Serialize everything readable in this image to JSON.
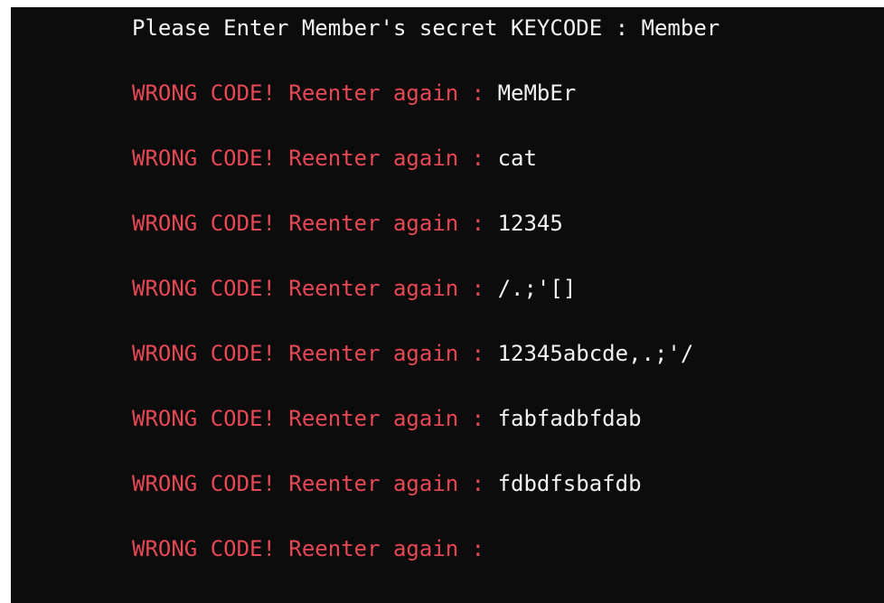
{
  "console": {
    "first_prompt": "Please Enter Member's secret KEYCODE : ",
    "first_input": "Member",
    "retry_prompt": "WRONG CODE! Reenter again : ",
    "retries": [
      "MeMbEr",
      "cat",
      "12345",
      "/.;'[]",
      "12345abcde,.;'/",
      "fabfadbfdab",
      "fdbdfsbafdb",
      ""
    ],
    "colors": {
      "background": "#0c0c0c",
      "default_text": "#f2f2f2",
      "error_text": "#e74856"
    }
  }
}
